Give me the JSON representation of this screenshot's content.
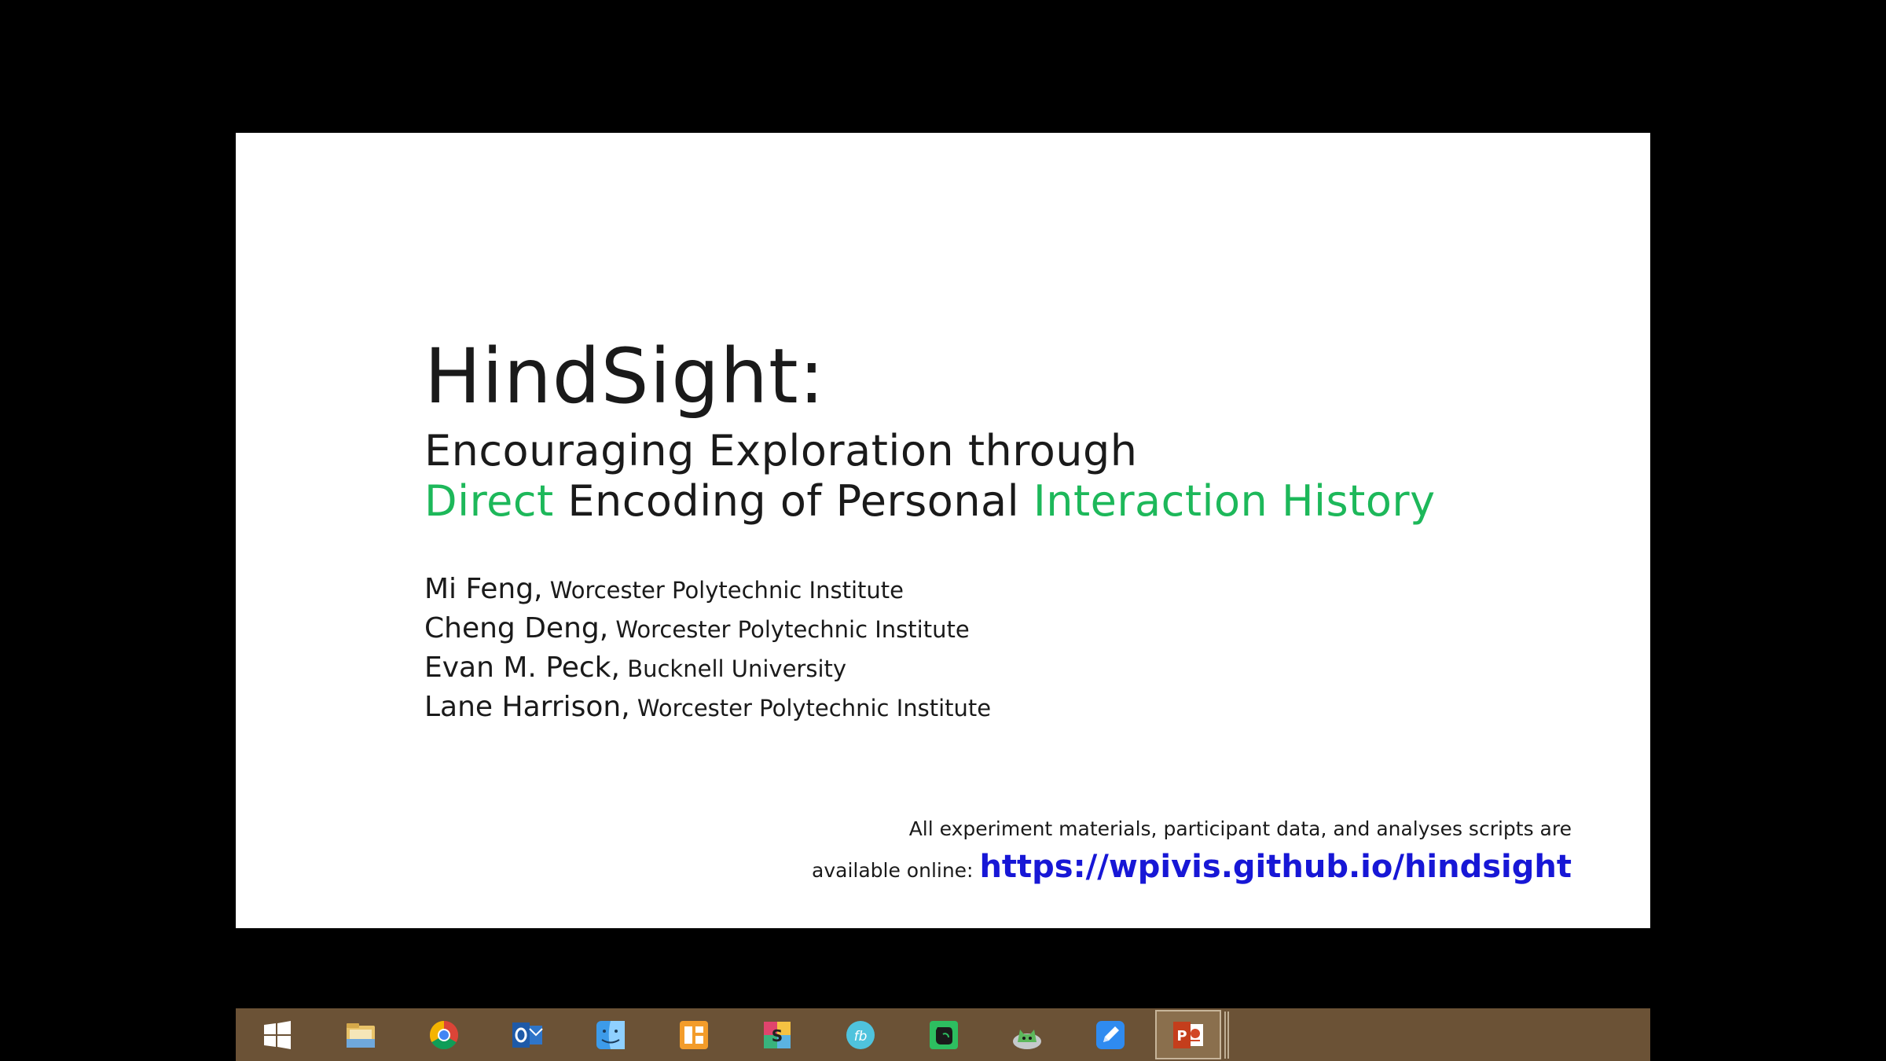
{
  "slide": {
    "title": "HindSight:",
    "subtitle_line1": "Encouraging Exploration through",
    "subtitle_line2": {
      "part1": "Direct",
      "part2": " Encoding of Personal ",
      "part3": "Interaction History"
    },
    "authors": [
      {
        "name": "Mi Feng,",
        "affiliation": " Worcester Polytechnic Institute"
      },
      {
        "name": "Cheng Deng,",
        "affiliation": " Worcester Polytechnic Institute"
      },
      {
        "name": "Evan M. Peck,",
        "affiliation": " Bucknell University"
      },
      {
        "name": "Lane Harrison,",
        "affiliation": " Worcester Polytechnic Institute"
      }
    ],
    "footer_line1": "All experiment materials, participant data, and analyses scripts are",
    "footer_line2_prefix": "available online: ",
    "footer_link": "https://wpivis.github.io/hindsight",
    "accent_green": "#1db85a",
    "link_blue": "#1717d6"
  },
  "taskbar": {
    "background": "#6b5236",
    "icons": [
      {
        "name": "windows-start-icon"
      },
      {
        "name": "file-explorer-icon"
      },
      {
        "name": "chrome-icon"
      },
      {
        "name": "outlook-icon"
      },
      {
        "name": "finder-style-app-icon"
      },
      {
        "name": "orange-app-icon"
      },
      {
        "name": "slack-style-app-icon"
      },
      {
        "name": "fb-circle-app-icon"
      },
      {
        "name": "evernote-icon"
      },
      {
        "name": "green-cat-app-icon"
      },
      {
        "name": "blue-pen-app-icon"
      },
      {
        "name": "powerpoint-icon",
        "active": true
      }
    ]
  }
}
